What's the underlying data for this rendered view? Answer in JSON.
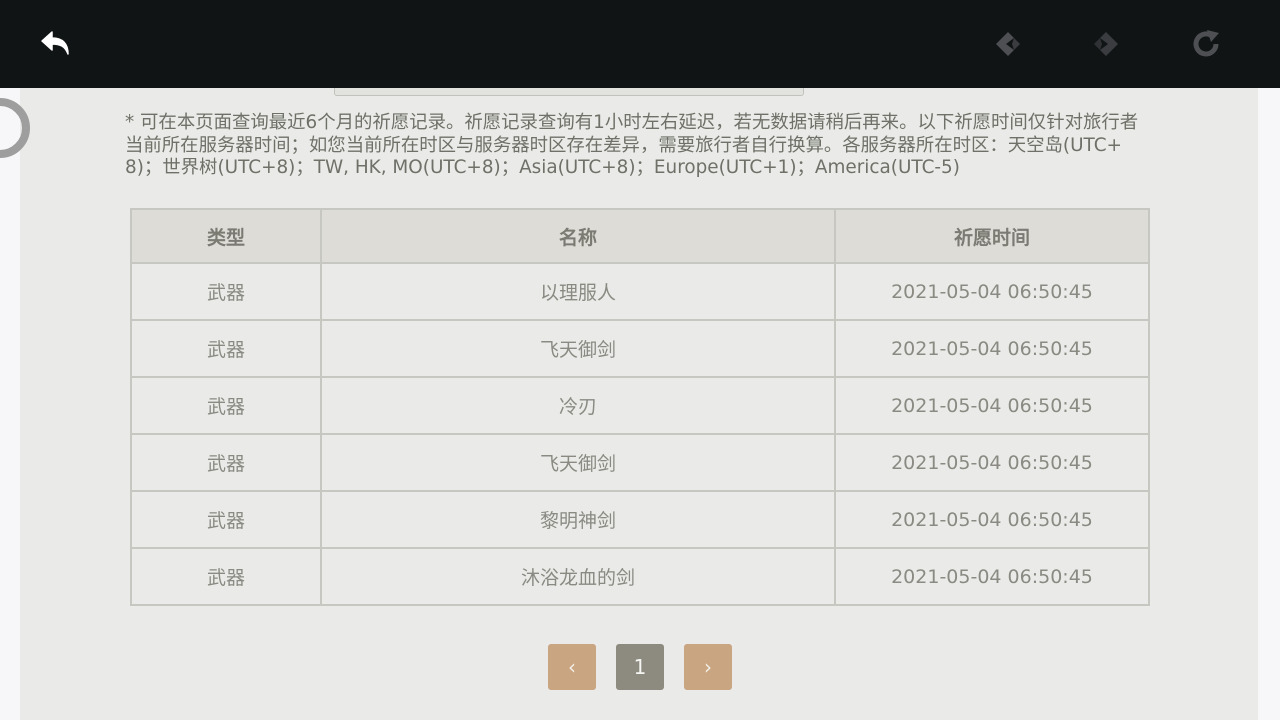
{
  "toolbar": {
    "back_icon": "back-arrow-icon",
    "prev_icon": "prev-diamond-icon",
    "next_icon": "next-diamond-icon",
    "reload_icon": "reload-icon"
  },
  "notice": {
    "text": "* 可在本页面查询最近6个月的祈愿记录。祈愿记录查询有1小时左右延迟，若无数据请稍后再来。以下祈愿时间仅针对旅行者当前所在服务器时间；如您当前所在时区与服务器时区存在差异，需要旅行者自行换算。各服务器所在时区：天空岛(UTC+8)；世界树(UTC+8)；TW, HK, MO(UTC+8)；Asia(UTC+8)；Europe(UTC+1)；America(UTC-5)"
  },
  "table": {
    "headers": [
      "类型",
      "名称",
      "祈愿时间"
    ],
    "rows": [
      [
        "武器",
        "以理服人",
        "2021-05-04 06:50:45"
      ],
      [
        "武器",
        "飞天御剑",
        "2021-05-04 06:50:45"
      ],
      [
        "武器",
        "冷刃",
        "2021-05-04 06:50:45"
      ],
      [
        "武器",
        "飞天御剑",
        "2021-05-04 06:50:45"
      ],
      [
        "武器",
        "黎明神剑",
        "2021-05-04 06:50:45"
      ],
      [
        "武器",
        "沐浴龙血的剑",
        "2021-05-04 06:50:45"
      ]
    ]
  },
  "pagination": {
    "prev_label": "‹",
    "current_page": "1",
    "next_label": "›"
  },
  "colors": {
    "topbar": "#101415",
    "panel": "#eaebe8",
    "header_bg": "#dddcd6",
    "pager_accent": "#c9a581",
    "pager_current": "#8d8a80"
  }
}
